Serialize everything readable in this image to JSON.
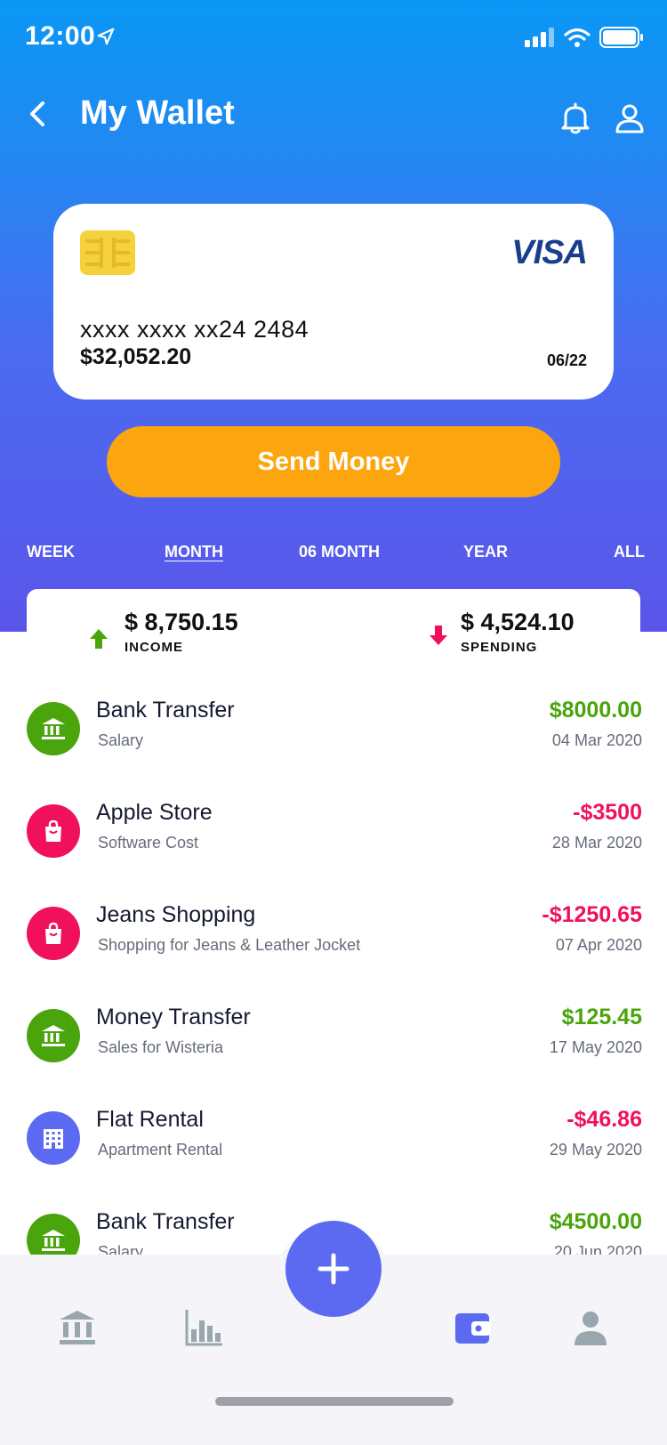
{
  "status": {
    "time": "12:00"
  },
  "header": {
    "title": "My Wallet"
  },
  "card": {
    "brand": "VISA",
    "number": "xxxx  xxxx  xx24  2484",
    "balance": "$32,052.20",
    "expiry": "06/22"
  },
  "send_button": "Send Money",
  "tabs": [
    {
      "label": "WEEK",
      "active": false
    },
    {
      "label": "MONTH",
      "active": true
    },
    {
      "label": "06 MONTH",
      "active": false
    },
    {
      "label": "YEAR",
      "active": false
    },
    {
      "label": "ALL",
      "active": false
    }
  ],
  "summary": {
    "income": {
      "amount": "$ 8,750.15",
      "label": "INCOME"
    },
    "spending": {
      "amount": "$ 4,524.10",
      "label": "SPENDING"
    }
  },
  "colors": {
    "positive": "#4aa40c",
    "negative": "#f0105c",
    "accent": "#5b6af0",
    "button": "#fda50f"
  },
  "transactions": [
    {
      "title": "Bank Transfer",
      "subtitle": "Salary",
      "amount": "$8000.00",
      "date": "04 Mar 2020",
      "icon": "bank-icon",
      "kind": "income"
    },
    {
      "title": "Apple Store",
      "subtitle": "Software Cost",
      "amount": "-$3500",
      "date": "28 Mar 2020",
      "icon": "shopping-bag-icon",
      "kind": "expense"
    },
    {
      "title": "Jeans Shopping",
      "subtitle": "Shopping for Jeans & Leather Jocket",
      "amount": "-$1250.65",
      "date": "07 Apr 2020",
      "icon": "shopping-bag-icon",
      "kind": "expense"
    },
    {
      "title": "Money Transfer",
      "subtitle": "Sales for Wisteria",
      "amount": "$125.45",
      "date": "17 May 2020",
      "icon": "bank-icon",
      "kind": "income"
    },
    {
      "title": "Flat Rental",
      "subtitle": "Apartment Rental",
      "amount": "-$46.86",
      "date": "29 May 2020",
      "icon": "building-icon",
      "kind": "rent"
    },
    {
      "title": "Bank Transfer",
      "subtitle": "Salary",
      "amount": "$4500.00",
      "date": "20 Jun 2020",
      "icon": "bank-icon",
      "kind": "income"
    }
  ],
  "bottom_nav": [
    {
      "icon": "bank-icon",
      "active": false
    },
    {
      "icon": "bar-chart-icon",
      "active": false
    },
    {
      "icon": "plus-icon",
      "active": true
    },
    {
      "icon": "wallet-icon",
      "active": true
    },
    {
      "icon": "user-icon",
      "active": false
    }
  ]
}
